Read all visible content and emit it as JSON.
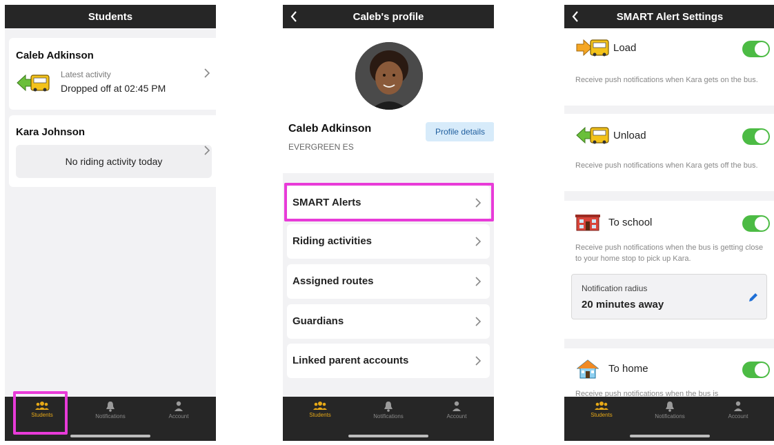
{
  "tabbar": {
    "tabs": [
      {
        "label": "Students",
        "icon": "students-icon"
      },
      {
        "label": "Notifications",
        "icon": "bell-icon"
      },
      {
        "label": "Account",
        "icon": "person-icon"
      }
    ]
  },
  "screen1": {
    "title": "Students",
    "students": [
      {
        "name": "Caleb Adkinson",
        "latest_label": "Latest activity",
        "latest_value": "Dropped off at 02:45 PM",
        "icon": "bus-unload-icon"
      },
      {
        "name": "Kara Johnson",
        "no_activity": "No riding activity today"
      }
    ]
  },
  "screen2": {
    "title": "Caleb's profile",
    "name": "Caleb Adkinson",
    "school": "EVERGREEN ES",
    "profile_details_label": "Profile details",
    "menu": [
      {
        "label": "SMART Alerts"
      },
      {
        "label": "Riding activities"
      },
      {
        "label": "Assigned routes"
      },
      {
        "label": "Guardians"
      },
      {
        "label": "Linked parent accounts"
      }
    ]
  },
  "screen3": {
    "title": "SMART Alert Settings",
    "alerts": [
      {
        "title": "Load",
        "desc": "Receive push notifications when Kara gets on the bus.",
        "icon": "bus-load-icon",
        "enabled": true
      },
      {
        "title": "Unload",
        "desc": "Receive push notifications when Kara gets off the bus.",
        "icon": "bus-unload-icon",
        "enabled": true
      },
      {
        "title": "To school",
        "desc": "Receive push notifications when the bus is getting close to your home stop to pick up Kara.",
        "icon": "school-icon",
        "enabled": true
      },
      {
        "title": "To home",
        "desc": "Receive push notifications when the bus is",
        "icon": "house-icon",
        "enabled": true
      }
    ],
    "radius": {
      "label": "Notification radius",
      "value": "20 minutes away"
    }
  },
  "colors": {
    "header_bg": "#262626",
    "accent_active": "#e6a817",
    "toggle_on": "#4cbb44",
    "highlight": "#e83bd8",
    "profile_button_bg": "#d7ebfa",
    "edit_blue": "#1f6fd6"
  }
}
